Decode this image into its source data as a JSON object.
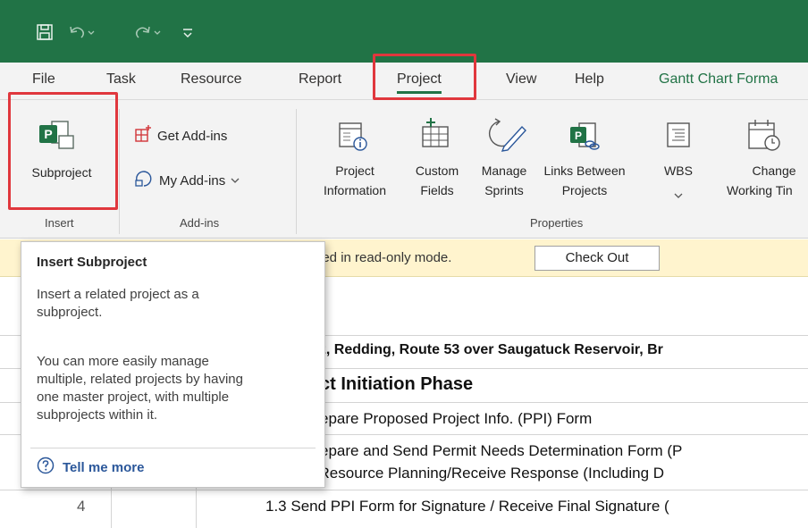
{
  "quick_access": {
    "save_icon": "save-icon",
    "undo_icon": "undo-icon",
    "redo_icon": "redo-icon",
    "customize_icon": "customize-icon"
  },
  "tabs": [
    {
      "label": "File"
    },
    {
      "label": "Task"
    },
    {
      "label": "Resource"
    },
    {
      "label": "Report"
    },
    {
      "label": "Project",
      "active": true
    },
    {
      "label": "View"
    },
    {
      "label": "Help"
    },
    {
      "label": "Gantt Chart Forma"
    }
  ],
  "ribbon": {
    "insert": {
      "subproject_label": "Subproject",
      "group_label": "Insert"
    },
    "addins": {
      "get_addins": "Get Add-ins",
      "my_addins": "My Add-ins",
      "group_label": "Add-ins"
    },
    "properties": {
      "group_label": "Properties",
      "project_info_1": "Project",
      "project_info_2": "Information",
      "custom_fields_1": "Custom",
      "custom_fields_2": "Fields",
      "manage_sprints_1": "Manage",
      "manage_sprints_2": "Sprints",
      "links_1": "Links Between",
      "links_2": "Projects",
      "wbs_1": "WBS",
      "change_1": "Change",
      "change_2": "Working Tin"
    }
  },
  "infobar": {
    "message": "ned in read-only mode.",
    "checkout_label": "Check Out"
  },
  "grid": {
    "rows": [
      "2, Redding, Route 53 over Saugatuck Reservoir, Br",
      "ct Initiation Phase",
      "epare Proposed Project Info. (PPI) Form",
      "epare and Send Permit Needs Determination Form (P",
      "Natural Resource Planning/Receive Response (Including D",
      "1.3 Send PPI Form for Signature / Receive Final Signature ("
    ],
    "row_number": "4"
  },
  "tooltip": {
    "title": "Insert Subproject",
    "line1": "Insert a related project as a",
    "line2": "subproject.",
    "line3": "You can more easily manage",
    "line4": "multiple, related projects by having",
    "line5": "one master project, with multiple",
    "line6": "subprojects within it.",
    "link": "Tell me more"
  },
  "colors": {
    "titlebar": "#217346",
    "accent": "#217346",
    "highlight": "#e0373d",
    "link": "#2b579a",
    "infobar": "#fff4ce"
  }
}
